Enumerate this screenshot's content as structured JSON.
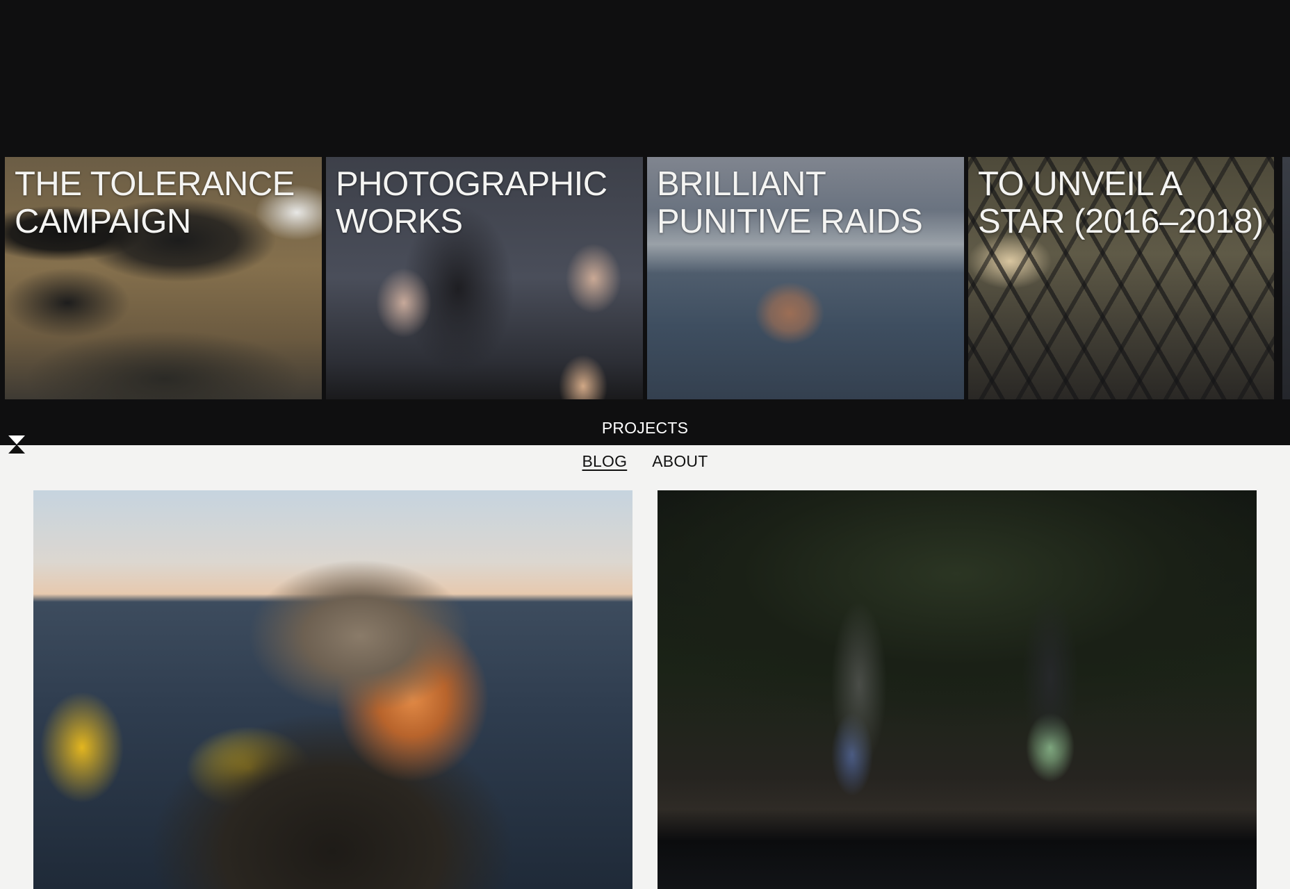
{
  "projects": {
    "cards": [
      {
        "title": "THE TOLERANCE CAMPAIGN"
      },
      {
        "title": "PHOTOGRAPHIC WORKS"
      },
      {
        "title": "BRILLIANT PUNITIVE RAIDS"
      },
      {
        "title": "TO UNVEIL A STAR (2016–2018)"
      }
    ]
  },
  "nav": {
    "projects_label": "PROJECTS",
    "blog_label": "BLOG",
    "about_label": "ABOUT"
  },
  "colors": {
    "dark_background": "#0f0f10",
    "light_background": "#f3f3f2",
    "nav_text_dark": "#111111",
    "nav_text_light": "#ffffff"
  },
  "icons": {
    "logo": "hourglass-logo-icon"
  }
}
